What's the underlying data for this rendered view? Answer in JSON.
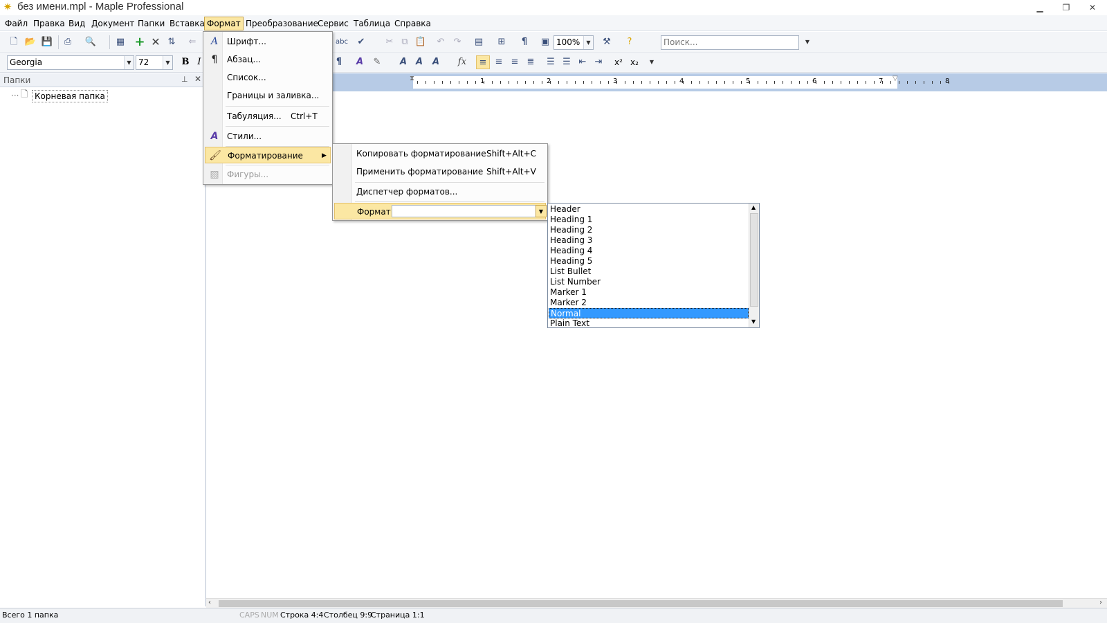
{
  "window": {
    "title": "без имени.mpl - Maple Professional",
    "icon": "app-logo-icon"
  },
  "menubar": {
    "items": [
      "Файл",
      "Правка",
      "Вид",
      "Документ",
      "Папки",
      "Вставка",
      "Формат",
      "Преобразование",
      "Сервис",
      "Таблица",
      "Справка"
    ],
    "active": "Формат"
  },
  "toolbar": {
    "zoom": "100%",
    "search_placeholder": "Поиск...",
    "font_name": "Georgia",
    "font_size": "72",
    "bold_label": "B",
    "italic_label": "I",
    "fx_label": "fx",
    "pilcrow": "¶"
  },
  "left_panel": {
    "title": "Папки",
    "root_folder": "Корневая папка"
  },
  "format_menu": {
    "items": [
      {
        "label": "Шрифт...",
        "icon": "font-icon"
      },
      {
        "label": "Абзац...",
        "icon": "paragraph-icon"
      },
      {
        "label": "Список..."
      },
      {
        "label": "Границы и заливка..."
      },
      {
        "label": "Табуляция...",
        "shortcut": "Ctrl+T"
      },
      {
        "label": "Стили...",
        "icon": "styles-icon"
      },
      {
        "label": "Форматирование",
        "icon": "brush-icon",
        "submenu": true
      },
      {
        "label": "Фигуры...",
        "icon": "shapes-icon",
        "disabled": true
      }
    ]
  },
  "formatting_submenu": {
    "items": [
      {
        "label": "Копировать форматирование",
        "shortcut": "Shift+Alt+C"
      },
      {
        "label": "Применить форматирование",
        "shortcut": "Shift+Alt+V"
      },
      {
        "label": "Диспетчер форматов..."
      }
    ],
    "format_label": "Формат"
  },
  "style_list": {
    "items": [
      "Header",
      "Heading 1",
      "Heading 2",
      "Heading 3",
      "Heading 4",
      "Heading 5",
      "List Bullet",
      "List Number",
      "Marker 1",
      "Marker 2",
      "Normal",
      "Plain Text"
    ],
    "selected": "Normal"
  },
  "ruler": {
    "numbers": [
      "1",
      "2",
      "3",
      "4",
      "5",
      "6",
      "7",
      "8"
    ]
  },
  "statusbar": {
    "folders": "Всего 1 папка",
    "caps": "CAPS",
    "num": "NUM",
    "row": "Строка 4:4",
    "col": "Столбец 9:9",
    "page": "Страница 1:1"
  },
  "colors": {
    "highlight": "#fbe7a3",
    "selection": "#3399ff",
    "ruler_bg": "#b7cbe6"
  }
}
